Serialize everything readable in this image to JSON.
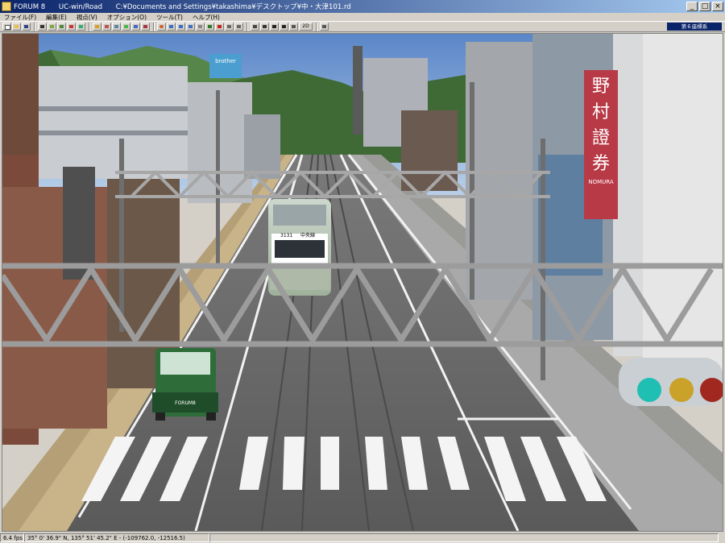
{
  "window": {
    "app_name": "FORUM 8",
    "product": "UC-win/Road",
    "path": "C:¥Documents and Settings¥takashima¥デスクトップ¥中・大津101.rd",
    "buttons": {
      "minimize": "_",
      "maximize": "□",
      "close": "×"
    }
  },
  "menu": {
    "items": [
      "ファイル(F)",
      "編集(E)",
      "視点(V)",
      "オプション(O)",
      "ツール(T)",
      "ヘルプ(H)"
    ]
  },
  "toolbar": {
    "mode_2d": "2D",
    "coordinate_system": "第６座標系"
  },
  "scene": {
    "signs": {
      "brother": "brother",
      "nomura_kanji": [
        "野",
        "村",
        "證",
        "券"
      ],
      "nomura_roman": "NOMURA",
      "truck_label": "FORUM8",
      "tram_destination": "中央線",
      "tram_number": "3131"
    },
    "traffic_signal_colors": [
      "#1fbfb4",
      "#caa22a",
      "#a0281e"
    ]
  },
  "status": {
    "fps": "6.4 fps",
    "coordinates": "35° 0' 36.9\" N, 135° 51' 45.2\" E - (-109762.0, -12516.5)"
  }
}
